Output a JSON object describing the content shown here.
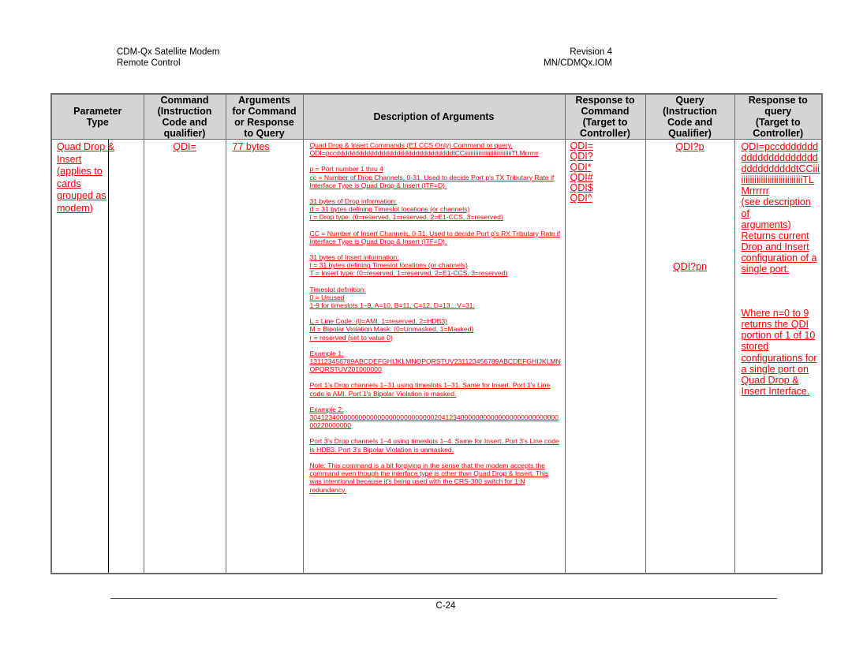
{
  "header": {
    "left_line1": "CDM-Qx Satellite Modem",
    "left_line2": "Remote Control",
    "right_line1": "Revision 4",
    "right_line2": "MN/CDMQx.IOM"
  },
  "table": {
    "columns": [
      {
        "line1": "Parameter",
        "line2": "Type"
      },
      {
        "line1": "Command",
        "line2": "(Instruction",
        "line3": "Code and",
        "line4": "qualifier)"
      },
      {
        "line1": "Arguments",
        "line2": "for Command",
        "line3": "or Response",
        "line4": "to Query"
      },
      {
        "line1": "Description of Arguments"
      },
      {
        "line1": "Response to",
        "line2": "Command",
        "line3": "(Target to",
        "line4": "Controller)"
      },
      {
        "line1": "Query",
        "line2": "(Instruction",
        "line3": "Code and",
        "line4": "Qualifier)"
      },
      {
        "line1": "Response to",
        "line2": "query",
        "line3": "(Target to",
        "line4": "Controller)"
      }
    ],
    "row": {
      "parameter_type": [
        "Quad Drop &",
        "Insert",
        "(applies to",
        "cards",
        "grouped as",
        "modem)"
      ],
      "command": "QDI=",
      "arguments": "77 bytes",
      "description": [
        [
          "Quad Drop & Insert Commands (E1 CCS Only) Command or query.",
          "QDI=pccdddddddddddddddddddddddddddddddtCCiiiiiiiiiiiiiiiiiiiiiiiiiiiiiiiTLMrrrrrr"
        ],
        [
          "p = Port number 1 thru 4",
          "cc = Number of Drop Channels, 0-31. Used to decide Port p's TX Tributary Rate if Interface Type is Quad Drop & Insert (ITF=D)."
        ],
        [
          "31 bytes of Drop information:",
          "d = 31 bytes defining Timeslot locations (or channels)",
          "t = Drop type: (0=reserved, 1=reserved, 2=E1-CCS, 3=reserved)"
        ],
        [
          "CC = Number of Insert Channels, 0-31. Used to decide Port p's RX Tributary Rate if Interface Type is Quad Drop & Insert (ITF=D)."
        ],
        [
          "31 bytes of Insert information:",
          "I = 31 bytes defining Timeslot locations (or channels)",
          "T = Insert type: (0=reserved, 1=reserved, 2=E1-CCS, 3=reserved)"
        ],
        [
          "Timeslot definition:",
          "0 = Unused",
          "1-9 for timeslots 1–9, A=10, B=11, C=12, D=13…V=31."
        ],
        [
          "L = Line Code: (0=AMI, 1=reserved, 2=HDB3)",
          "M = Bipolar Violation Mask: (0=Unmasked, 1=Masked)",
          "r = reserved (set to value 0)"
        ],
        [
          "Example 1:",
          "131123456789ABCDEFGHIJKLMNOPQRSTUV231123456789ABCDEFGHIJKLMNOPQRSTUV201000000"
        ],
        [
          "Port 1's Drop channels 1–31 using timeslots 1–31. Same for Insert. Port 1's Line code is AMI. Port 1's Bipolar Violation is masked."
        ],
        [
          "Example 2:",
          "30412340000000000000000000000000020412340000000000000000000000000000220000000"
        ],
        [
          "Port 3's Drop channels 1–4 using timeslots 1–4. Same for Insert. Port 3's Line code is HDB3. Port 3's Bipolar Violation is unmasked."
        ],
        [
          "Note: This command is a bit forgiving in the sense that the modem accepts the command even though the interface type is other than Quad Drop & Insert. This was intentional because it's being used with the CRS-300 switch for 1:N redundancy."
        ]
      ],
      "response_to_command": [
        "QDI=",
        "QDI?",
        "QDI*",
        "QDI#",
        "QDI$",
        "QDI^"
      ],
      "query": [
        "QDI?p",
        "QDI?pn"
      ],
      "response_to_query_1": [
        "QDI=pccddddddd",
        "dddddddddddddd",
        "ddddddddddtCCiii",
        "iiiiiiiiiiiiiiiiiiiiiiiiiiiiTL",
        "Mrrrrrr",
        "(see description of",
        "arguments)",
        "Returns current",
        "Drop and Insert",
        "configuration of a",
        "single port."
      ],
      "response_to_query_2": [
        "Where n=0 to 9",
        "returns the QDI",
        "portion of 1 of 10",
        "stored",
        "configurations for",
        "a single port on",
        "Quad Drop &",
        "Insert Interface."
      ]
    }
  },
  "footer": {
    "page_number": "C-24"
  }
}
